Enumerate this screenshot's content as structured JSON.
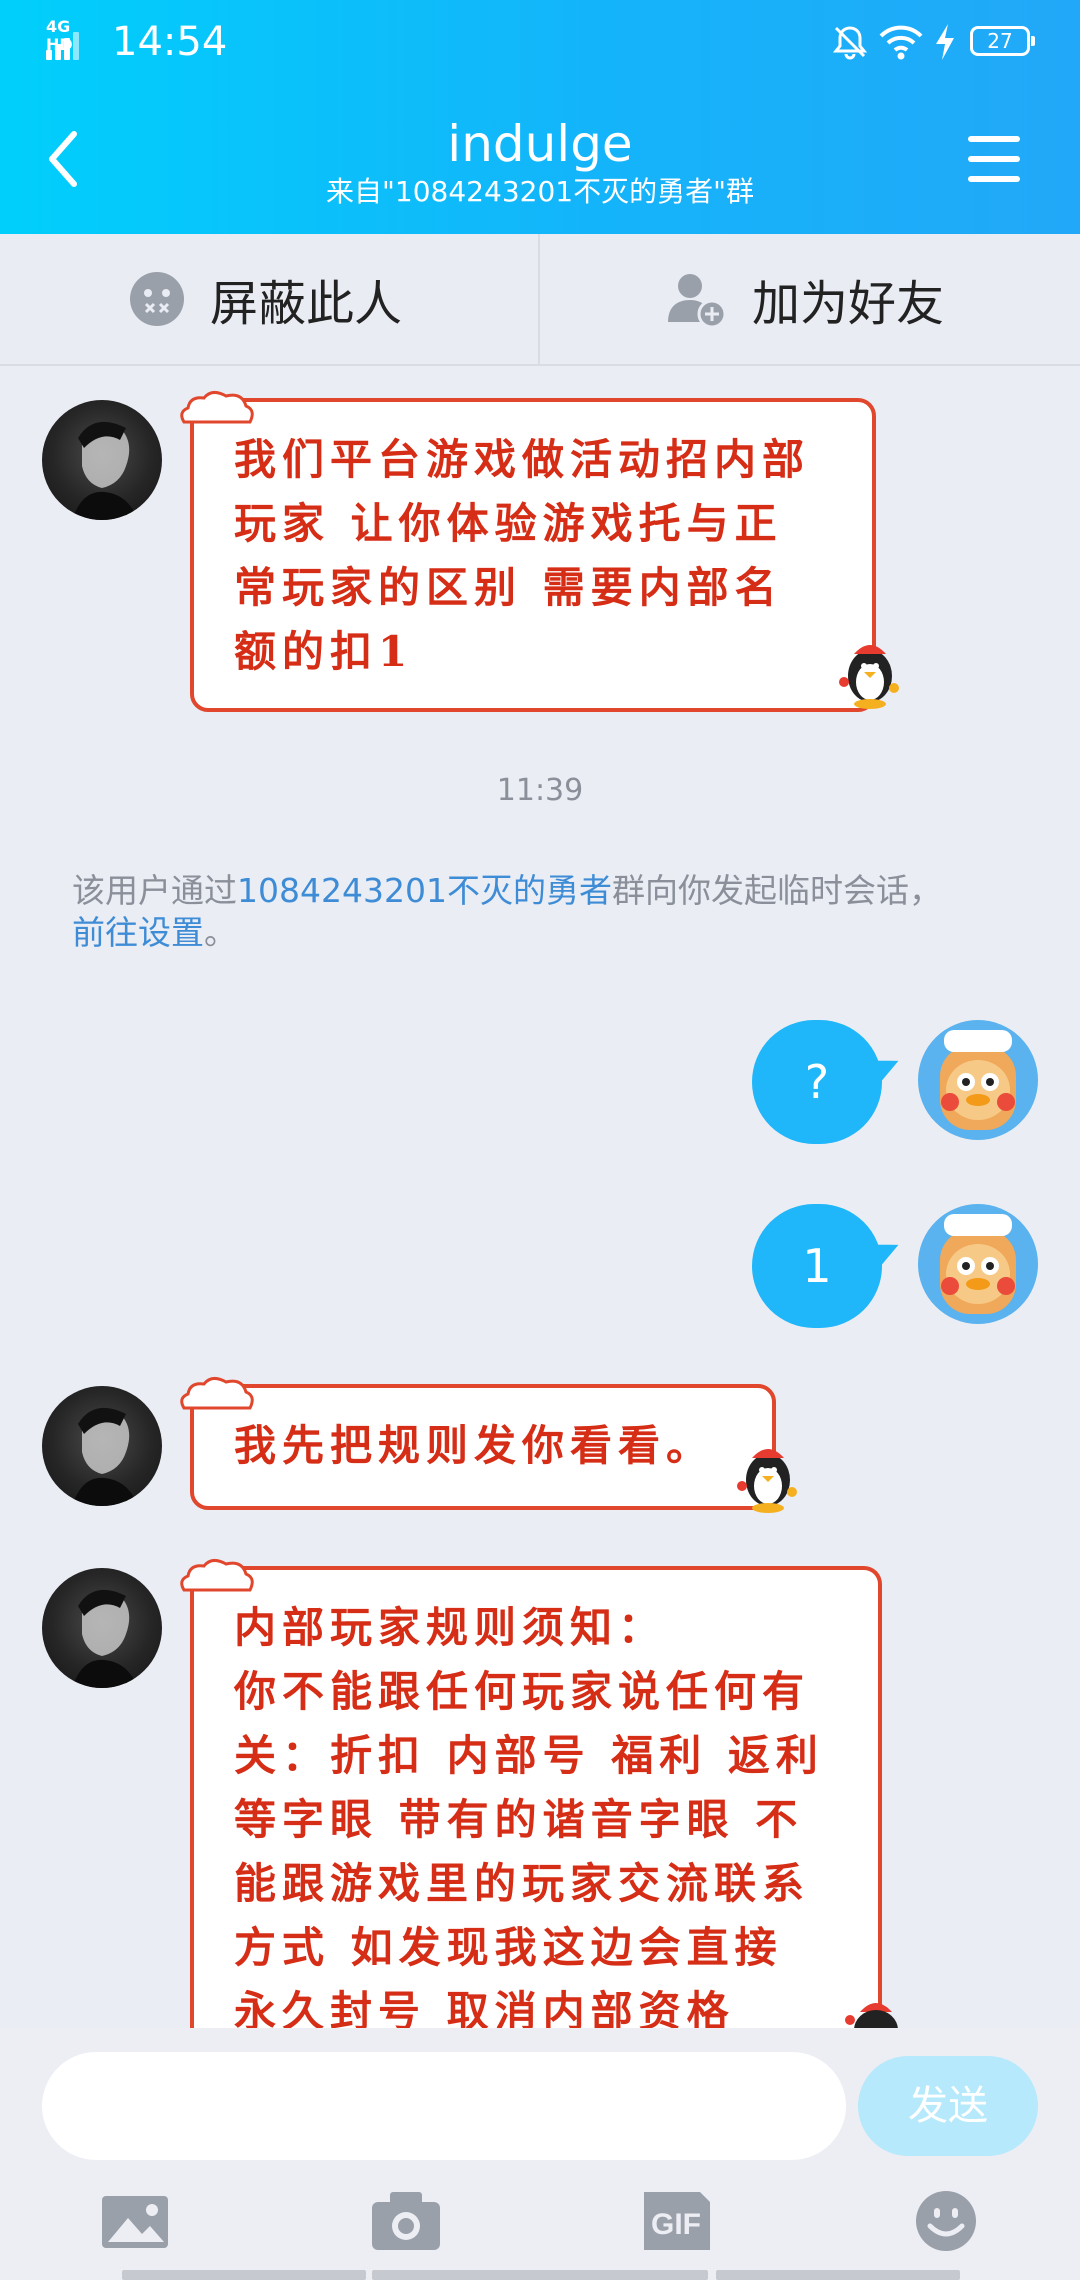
{
  "status_bar": {
    "network": "4G HD",
    "time": "14:54",
    "battery": "27"
  },
  "header": {
    "title": "indulge",
    "subtitle": "来自\"1084243201不灭的勇者\"群"
  },
  "actions": {
    "block_label": "屏蔽此人",
    "add_friend_label": "加为好友"
  },
  "messages": {
    "m1_lines": [
      "我们平台游戏做活动招内部",
      "玩家 让你体验游戏托与正",
      "常玩家的区别 需要内部名",
      "额的扣1"
    ],
    "timestamp": "11:39",
    "system_prefix": "该用户通过",
    "system_group_link": "1084243201不灭的勇者",
    "system_middle": "群向你发起临时会话，",
    "system_settings_link": "前往设置",
    "system_end": "。",
    "m2": "?",
    "m3": "1",
    "m4": "我先把规则发你看看。",
    "m5_lines": [
      "内部玩家规则须知：",
      "你不能跟任何玩家说任何有",
      "关：折扣 内部号 福利 返利",
      "等字眼 带有的谐音字眼 不",
      "能跟游戏里的玩家交流联系",
      "方式 如发现我这边会直接",
      "永久封号 取消内部资格"
    ]
  },
  "composer": {
    "input_value": "",
    "send_label": "发送"
  },
  "icons": {
    "back": "chevron-left-icon",
    "menu": "hamburger-menu-icon",
    "block": "block-user-icon",
    "add_friend": "add-friend-icon",
    "image": "image-icon",
    "camera": "camera-icon",
    "gif": "gif-icon",
    "emoji": "emoji-icon"
  },
  "colors": {
    "header_gradient_start": "#00cffb",
    "header_gradient_end": "#22a8f8",
    "outgoing_bubble": "#1fb6fa",
    "incoming_text": "#d52d16",
    "incoming_border": "#e0472c",
    "link": "#3e8cd6",
    "send_button": "#b6e9fb"
  }
}
